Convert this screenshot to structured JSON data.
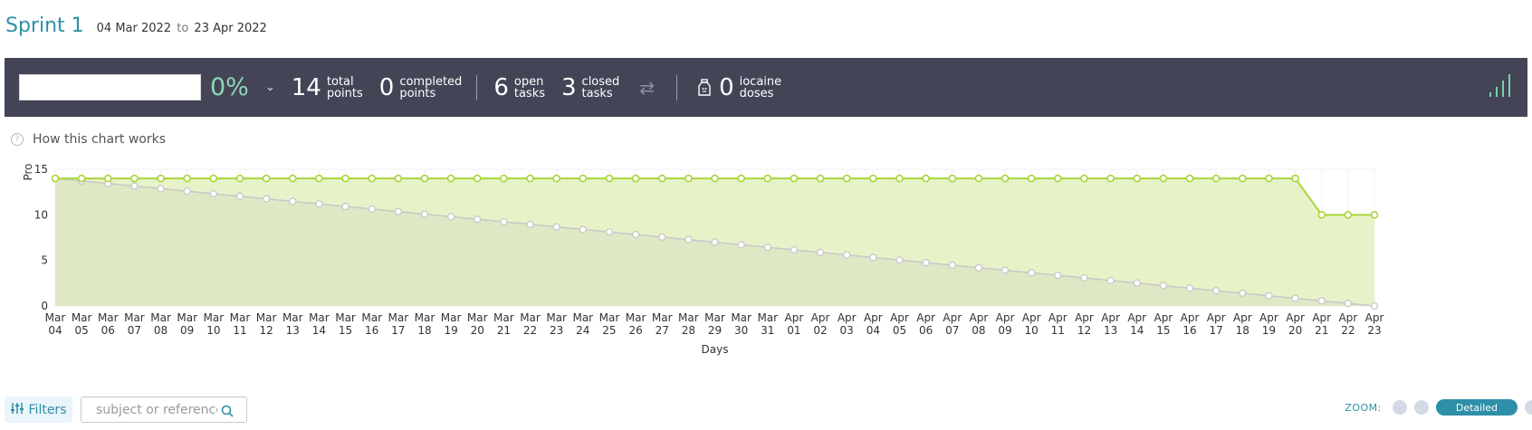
{
  "sprint": {
    "title": "Sprint 1",
    "start": "04 Mar 2022",
    "range_sep": "to",
    "end": "23 Apr 2022"
  },
  "summary": {
    "percent": "0%",
    "total_points": "14",
    "total_label_1": "total",
    "total_label_2": "points",
    "completed_points": "0",
    "completed_label_1": "completed",
    "completed_label_2": "points",
    "open_tasks": "6",
    "open_label_1": "open",
    "open_label_2": "tasks",
    "closed_tasks": "3",
    "closed_label_1": "closed",
    "closed_label_2": "tasks",
    "iocaine": "0",
    "iocaine_label_1": "iocaine",
    "iocaine_label_2": "doses"
  },
  "help": {
    "label": "How this chart works"
  },
  "filters": {
    "label": "Filters"
  },
  "search": {
    "placeholder": "subject or reference"
  },
  "zoom": {
    "label": "ZOOM:",
    "active": "Detailed"
  },
  "colors": {
    "accent": "#2e8fa8",
    "bar_bg": "#434557",
    "percent": "#8ed6b8",
    "actual_line": "#a8d63b",
    "ideal_line": "#c8c8c8",
    "actual_fill": "#e8f2c8",
    "ideal_fill": "#dce6c4"
  },
  "chart_data": {
    "type": "line",
    "ylabel": "Pro",
    "xlabel": "Days",
    "ylim": [
      0,
      15
    ],
    "yticks": [
      0,
      5,
      10,
      15
    ],
    "categories": [
      [
        "Mar",
        "04"
      ],
      [
        "Mar",
        "05"
      ],
      [
        "Mar",
        "06"
      ],
      [
        "Mar",
        "07"
      ],
      [
        "Mar",
        "08"
      ],
      [
        "Mar",
        "09"
      ],
      [
        "Mar",
        "10"
      ],
      [
        "Mar",
        "11"
      ],
      [
        "Mar",
        "12"
      ],
      [
        "Mar",
        "13"
      ],
      [
        "Mar",
        "14"
      ],
      [
        "Mar",
        "15"
      ],
      [
        "Mar",
        "16"
      ],
      [
        "Mar",
        "17"
      ],
      [
        "Mar",
        "18"
      ],
      [
        "Mar",
        "19"
      ],
      [
        "Mar",
        "20"
      ],
      [
        "Mar",
        "21"
      ],
      [
        "Mar",
        "22"
      ],
      [
        "Mar",
        "23"
      ],
      [
        "Mar",
        "24"
      ],
      [
        "Mar",
        "25"
      ],
      [
        "Mar",
        "26"
      ],
      [
        "Mar",
        "27"
      ],
      [
        "Mar",
        "28"
      ],
      [
        "Mar",
        "29"
      ],
      [
        "Mar",
        "30"
      ],
      [
        "Mar",
        "31"
      ],
      [
        "Apr",
        "01"
      ],
      [
        "Apr",
        "02"
      ],
      [
        "Apr",
        "03"
      ],
      [
        "Apr",
        "04"
      ],
      [
        "Apr",
        "05"
      ],
      [
        "Apr",
        "06"
      ],
      [
        "Apr",
        "07"
      ],
      [
        "Apr",
        "08"
      ],
      [
        "Apr",
        "09"
      ],
      [
        "Apr",
        "10"
      ],
      [
        "Apr",
        "11"
      ],
      [
        "Apr",
        "12"
      ],
      [
        "Apr",
        "13"
      ],
      [
        "Apr",
        "14"
      ],
      [
        "Apr",
        "15"
      ],
      [
        "Apr",
        "16"
      ],
      [
        "Apr",
        "17"
      ],
      [
        "Apr",
        "18"
      ],
      [
        "Apr",
        "19"
      ],
      [
        "Apr",
        "20"
      ],
      [
        "Apr",
        "21"
      ],
      [
        "Apr",
        "22"
      ],
      [
        "Apr",
        "23"
      ]
    ],
    "series": [
      {
        "role": "actual",
        "values": [
          14,
          14,
          14,
          14,
          14,
          14,
          14,
          14,
          14,
          14,
          14,
          14,
          14,
          14,
          14,
          14,
          14,
          14,
          14,
          14,
          14,
          14,
          14,
          14,
          14,
          14,
          14,
          14,
          14,
          14,
          14,
          14,
          14,
          14,
          14,
          14,
          14,
          14,
          14,
          14,
          14,
          14,
          14,
          14,
          14,
          14,
          14,
          14,
          10,
          10,
          10
        ]
      },
      {
        "role": "ideal",
        "values": [
          14,
          13.72,
          13.44,
          13.16,
          12.88,
          12.6,
          12.32,
          12.04,
          11.76,
          11.48,
          11.2,
          10.92,
          10.64,
          10.36,
          10.08,
          9.8,
          9.52,
          9.24,
          8.96,
          8.68,
          8.4,
          8.12,
          7.84,
          7.56,
          7.28,
          7,
          6.72,
          6.44,
          6.16,
          5.88,
          5.6,
          5.32,
          5.04,
          4.76,
          4.48,
          4.2,
          3.92,
          3.64,
          3.36,
          3.08,
          2.8,
          2.52,
          2.24,
          1.96,
          1.68,
          1.4,
          1.12,
          0.84,
          0.56,
          0.28,
          0
        ]
      }
    ],
    "grid": true,
    "legend": "none"
  }
}
